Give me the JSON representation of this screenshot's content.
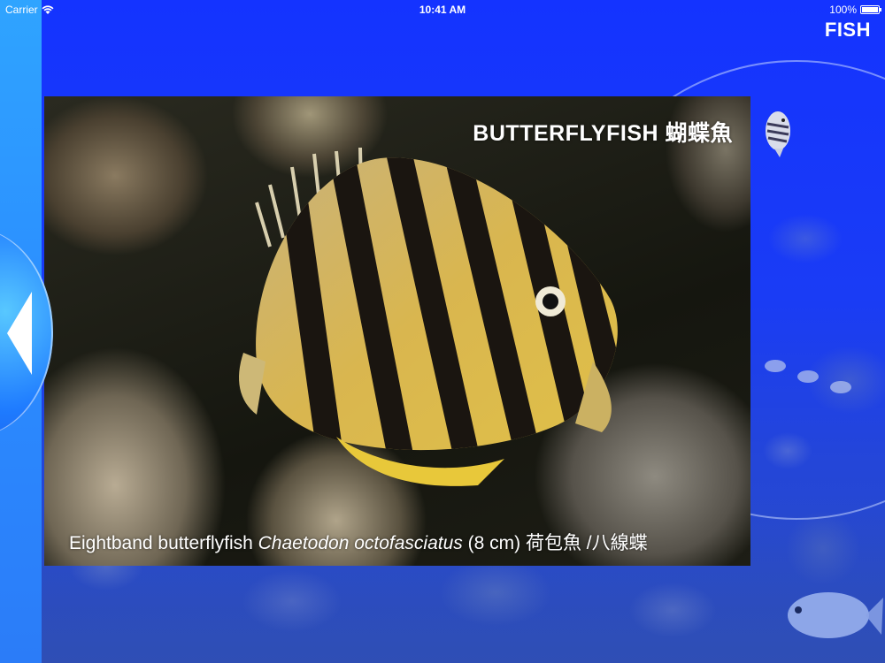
{
  "status_bar": {
    "carrier": "Carrier",
    "time": "10:41 AM",
    "battery_percent": "100%",
    "battery_level": 1.0
  },
  "nav": {
    "title": "FISH"
  },
  "photo": {
    "title": "BUTTERFLYFISH 蝴蝶魚",
    "caption_common": "Eightband butterflyfish",
    "caption_scientific": "Chaetodon octofasciatus",
    "caption_size_and_chinese": "(8 cm) 荷包魚 /八線蝶"
  },
  "icons": {
    "wifi": "wifi-icon",
    "battery": "battery-icon",
    "back": "chevron-left-icon"
  },
  "colors": {
    "background": "#1a34ff",
    "left_strip": "#2b8cff",
    "button": "#1f7cff",
    "text": "#ffffff"
  }
}
